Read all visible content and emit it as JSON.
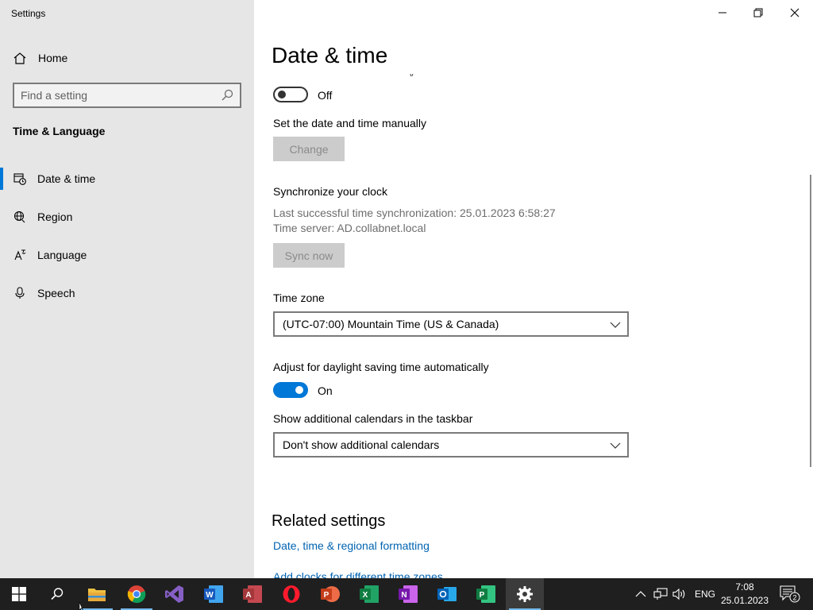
{
  "window": {
    "title": "Settings"
  },
  "sidebar": {
    "home_label": "Home",
    "search_placeholder": "Find a setting",
    "section_title": "Time & Language",
    "items": [
      {
        "label": "Date & time",
        "icon": "calendar-clock-icon",
        "active": true
      },
      {
        "label": "Region",
        "icon": "globe-icon",
        "active": false
      },
      {
        "label": "Language",
        "icon": "language-icon",
        "active": false
      },
      {
        "label": "Speech",
        "icon": "microphone-icon",
        "active": false
      }
    ]
  },
  "main": {
    "page_title": "Date & time",
    "auto_time_toggle": {
      "state": "Off"
    },
    "manual": {
      "label": "Set the date and time manually",
      "button": "Change"
    },
    "sync": {
      "label": "Synchronize your clock",
      "last_sync": "Last successful time synchronization: 25.01.2023 6:58:27",
      "server": "Time server: AD.collabnet.local",
      "button": "Sync now"
    },
    "timezone": {
      "label": "Time zone",
      "value": "(UTC-07:00) Mountain Time (US & Canada)"
    },
    "dst": {
      "label": "Adjust for daylight saving time automatically",
      "state": "On"
    },
    "calendars": {
      "label": "Show additional calendars in the taskbar",
      "value": "Don't show additional calendars"
    },
    "related": {
      "title": "Related settings",
      "links": [
        "Date, time & regional formatting",
        "Add clocks for different time zones"
      ]
    }
  },
  "taskbar": {
    "apps": [
      "start",
      "search",
      "file-explorer",
      "chrome",
      "visual-studio",
      "word",
      "access",
      "opera",
      "powerpoint",
      "excel",
      "onenote",
      "outlook",
      "project",
      "settings"
    ],
    "language": "ENG",
    "time": "7:08",
    "date": "25.01.2023",
    "notification_count": "2"
  },
  "colors": {
    "accent": "#0078d7",
    "sidebar_bg": "#e6e6e6",
    "taskbar_bg": "#1f1f1f",
    "link": "#0063b1"
  }
}
